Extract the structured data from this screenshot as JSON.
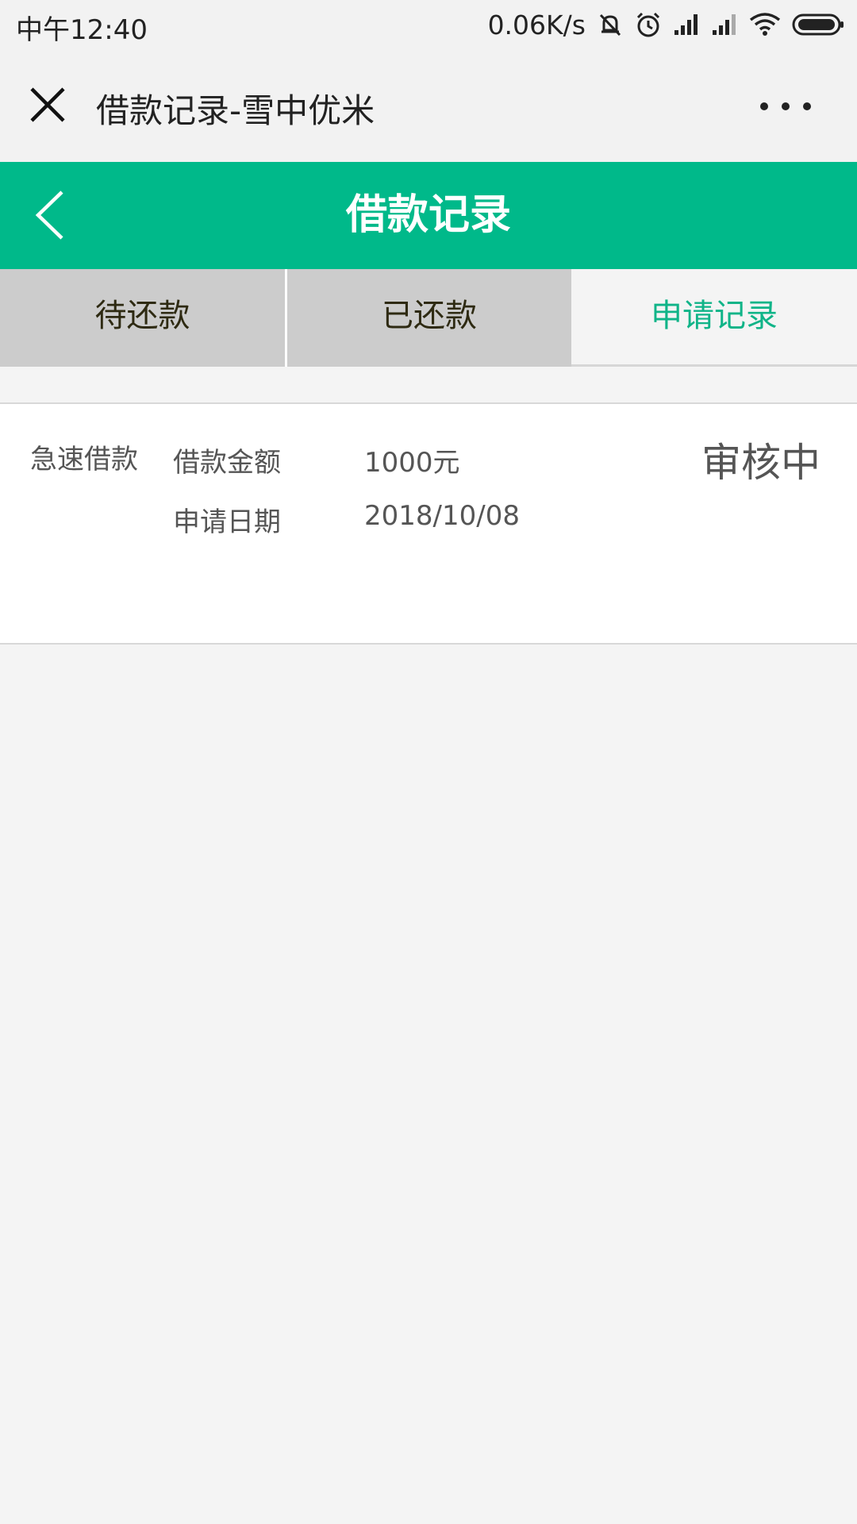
{
  "status_bar": {
    "time": "中午12:40",
    "net_speed": "0.06K/s",
    "icons": [
      "mute-icon",
      "alarm-icon",
      "signal-icon",
      "signal-icon",
      "wifi-icon",
      "battery-icon"
    ]
  },
  "title_bar": {
    "title": "借款记录-雪中优米",
    "close_icon": "close-icon",
    "more_icon": "more-icon"
  },
  "header": {
    "title": "借款记录",
    "back_icon": "chevron-left-icon",
    "color": "#00b98a"
  },
  "tabs": [
    {
      "label": "待还款",
      "active": false
    },
    {
      "label": "已还款",
      "active": false
    },
    {
      "label": "申请记录",
      "active": true
    }
  ],
  "records": [
    {
      "type": "急速借款",
      "amount_label": "借款金额",
      "amount_value": "1000元",
      "date_label": "申请日期",
      "date_value": "2018/10/08",
      "status": "审核中"
    }
  ]
}
